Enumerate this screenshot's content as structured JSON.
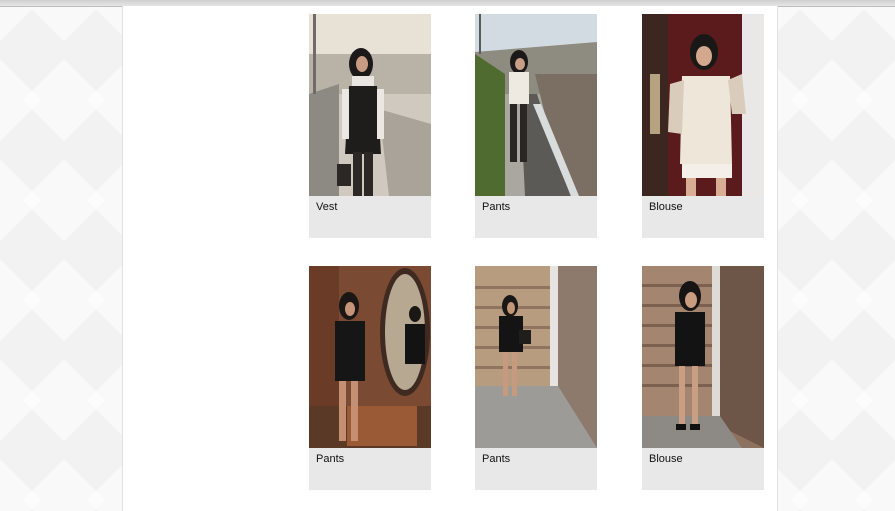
{
  "colors": {
    "page_bg": "#f2f2f2",
    "content_bg": "#ffffff",
    "card_bg": "#e8e8e8",
    "caption_text": "#111111"
  },
  "products": [
    {
      "label": "Vest"
    },
    {
      "label": "Pants"
    },
    {
      "label": "Blouse"
    },
    {
      "label": "Pants"
    },
    {
      "label": "Pants"
    },
    {
      "label": "Blouse"
    }
  ]
}
